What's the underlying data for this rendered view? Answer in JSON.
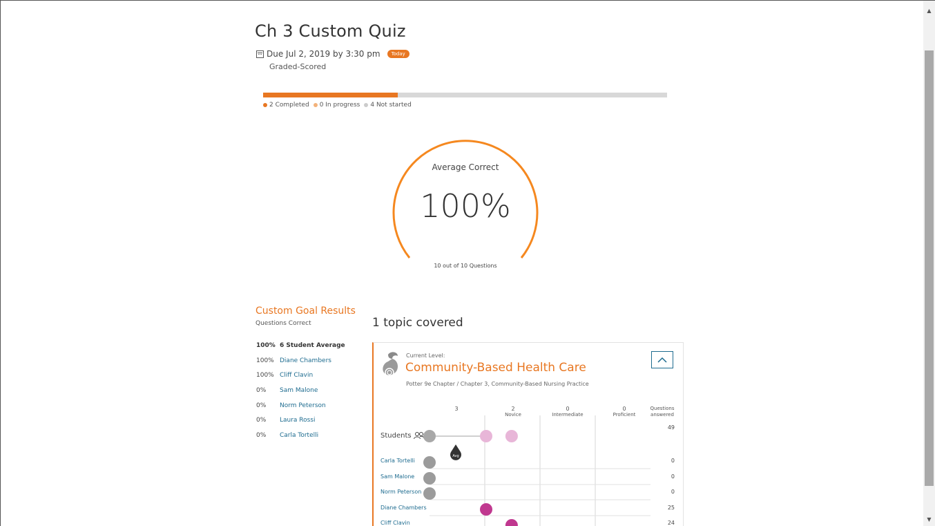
{
  "quiz": {
    "title": "Ch 3 Custom Quiz",
    "due": "Due Jul 2, 2019 by 3:30 pm",
    "badge": "Today",
    "grading": "Graded-Scored"
  },
  "progress": {
    "completed_fraction": 0.333,
    "legend": [
      {
        "label": "2 Completed",
        "color": "#e87722"
      },
      {
        "label": "0 In progress",
        "color": "#f3b27a"
      },
      {
        "label": "4 Not started",
        "color": "#cccccc"
      }
    ]
  },
  "gauge": {
    "label": "Average Correct",
    "value": "100%",
    "subtext": "10 out of 10 Questions",
    "color": "#f5881f"
  },
  "goals": {
    "title": "Custom Goal Results",
    "subtitle": "Questions Correct",
    "rows": [
      {
        "pct": "100%",
        "name": "6 Student Average",
        "bold": true
      },
      {
        "pct": "100%",
        "name": "Diane Chambers"
      },
      {
        "pct": "100%",
        "name": "Cliff Clavin"
      },
      {
        "pct": "0%",
        "name": "Sam Malone"
      },
      {
        "pct": "0%",
        "name": "Norm Peterson"
      },
      {
        "pct": "0%",
        "name": "Laura Rossi"
      },
      {
        "pct": "0%",
        "name": "Carla Tortelli"
      }
    ]
  },
  "topics": {
    "heading": "1 topic covered",
    "card": {
      "current_level_label": "Current Level:",
      "name": "Community-Based Health Care",
      "path": "Potter 9e Chapter / Chapter 3, Community-Based Nursing Practice",
      "columns": [
        {
          "count": "3",
          "label": ""
        },
        {
          "count": "2",
          "label": "Novice"
        },
        {
          "count": "0",
          "label": "Intermediate"
        },
        {
          "count": "0",
          "label": "Proficient"
        }
      ],
      "answered_header": "Questions answered",
      "students_label": "Students",
      "students_total": "49",
      "avg_marker_label": "Avg",
      "rows": [
        {
          "name": "Carla Tortelli",
          "count": "0",
          "level": 0
        },
        {
          "name": "Sam Malone",
          "count": "0",
          "level": 0
        },
        {
          "name": "Norm Peterson",
          "count": "0",
          "level": 0
        },
        {
          "name": "Diane Chambers",
          "count": "25",
          "level": 1
        },
        {
          "name": "Cliff Clavin",
          "count": "24",
          "level": 1.45
        }
      ]
    }
  },
  "colors": {
    "accent": "#e87722",
    "link": "#1d6b8f",
    "grey_dot": "#9b9b9b",
    "novice_dot": "#c0388f",
    "pink_dot": "#e8b6d8"
  }
}
